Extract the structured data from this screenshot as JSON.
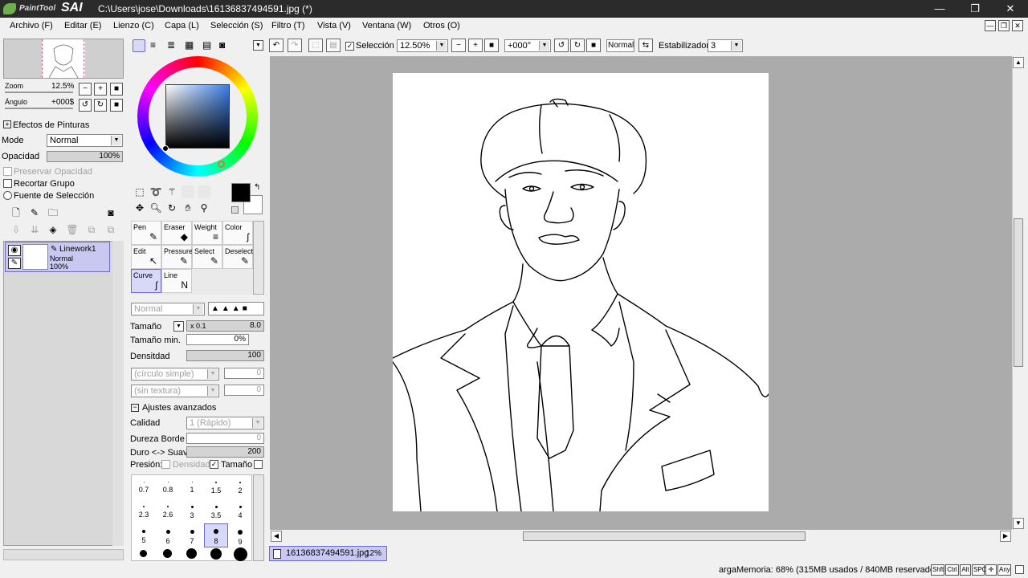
{
  "app": {
    "logo_small": "PaintTool",
    "logo_big": "SAI",
    "window_title": "C:\\Users\\jose\\Downloads\\16136837494591.jpg (*)"
  },
  "menu": [
    "Archivo (F)",
    "Editar (E)",
    "Lienzo (C)",
    "Capa (L)",
    "Selección (S)",
    "Filtro (T)",
    "Vista (V)",
    "Ventana (W)",
    "Otros (O)"
  ],
  "navigator": {
    "zoom_label": "Zoom",
    "zoom_value": "12.5%",
    "angle_label": "Ángulo",
    "angle_value": "+000$"
  },
  "layer_panel": {
    "effects_label": "Efectos de Pinturas",
    "mode_label": "Mode",
    "mode_value": "Normal",
    "opacity_label": "Opacidad",
    "opacity_value": "100%",
    "preserve_opacity": "Preservar Opacidad",
    "clip_group": "Recortar Grupo",
    "selection_source": "Fuente de Selección",
    "layer": {
      "name": "Linework1",
      "mode": "Normal",
      "opacity": "100%"
    }
  },
  "tools": {
    "grid": [
      {
        "label": "Pen",
        "glyph": "✎"
      },
      {
        "label": "Eraser",
        "glyph": "◆"
      },
      {
        "label": "Weight",
        "glyph": "≡"
      },
      {
        "label": "Color",
        "glyph": "ʃ"
      },
      {
        "label": "Edit",
        "glyph": "↖"
      },
      {
        "label": "Pressure",
        "glyph": "✎"
      },
      {
        "label": "Select",
        "glyph": "✎"
      },
      {
        "label": "Deselect",
        "glyph": "✎"
      },
      {
        "label": "Curve",
        "glyph": "ʃ"
      },
      {
        "label": "Line",
        "glyph": "N"
      }
    ],
    "mode_value": "Normal",
    "size_label": "Tamaño",
    "size_multiplier": "x 0.1",
    "size_value": "8.0",
    "min_size_label": "Tamaño min.",
    "min_size_value": "0%",
    "density_label": "Densitdad",
    "density_value": "100",
    "shape_value": "(círculo simple)",
    "shape_num": "0",
    "texture_value": "(sin textura)",
    "texture_num": "0",
    "advanced_label": "Ajustes avanzados",
    "quality_label": "Calidad",
    "quality_value": "1 (Rápido)",
    "hardness_label": "Dureza Borde",
    "hardness_value": "0",
    "soft_label": "Duro <-> Suave",
    "soft_value": "200",
    "pressure_label": "Presión:",
    "pressure_density": "Densidad",
    "pressure_size": "Tamaño",
    "brush_sizes": [
      [
        "0.7",
        "0.8",
        "1",
        "1.5",
        "2"
      ],
      [
        "2.3",
        "2.6",
        "3",
        "3.5",
        "4"
      ],
      [
        "5",
        "6",
        "7",
        "8",
        "9"
      ]
    ]
  },
  "toolbar": {
    "selection_label": "Selección",
    "zoom_value": "12.50%",
    "angle_value": "+000°",
    "blend_value": "Normal",
    "stabilizer_label": "Estabilizador",
    "stabilizer_value": "3"
  },
  "document": {
    "tab_name": "16136837494591.jpg",
    "tab_zoom": "12%"
  },
  "status": {
    "memory": "argaMemoria: 68% (315MB usados / 840MB reservados)",
    "keys": [
      "Shft",
      "Ctrl",
      "Alt",
      "SPC",
      "✛",
      "Any"
    ]
  },
  "colors": {
    "accent": "#6a6ad0",
    "selected_bg": "#c8c8f0",
    "titlebar": "#2b2b2b",
    "canvas_bg": "#ababab"
  }
}
